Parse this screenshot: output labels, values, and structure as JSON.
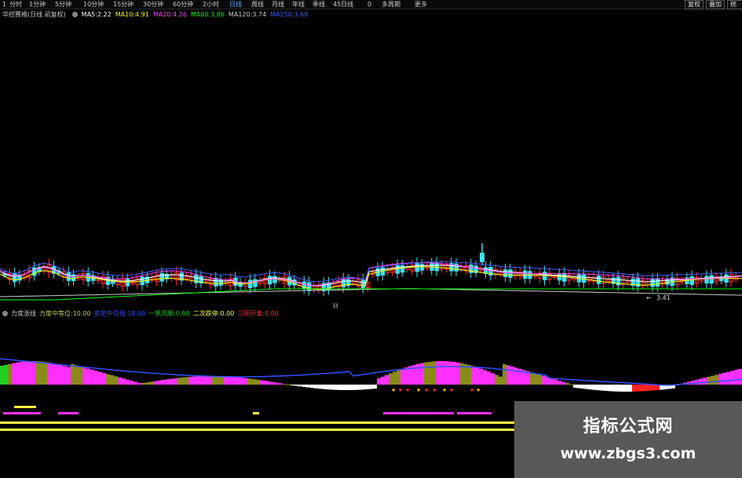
{
  "toolbar": {
    "timeframes": [
      "1",
      "分时",
      "1分钟",
      "5分钟",
      "10分钟",
      "15分钟",
      "30分钟",
      "60分钟",
      "2小时",
      "日线",
      "周线",
      "月线",
      "年线",
      "季线",
      "45日线",
      "0",
      "多周期",
      "更多"
    ],
    "active_timeframe": "日线",
    "right_buttons": [
      "复权",
      "叠加",
      "统计"
    ]
  },
  "main_info": {
    "stock": "华控赛格(日线 前复权)",
    "ma5_label": "MA5:",
    "ma5_value": "2.22",
    "ma10_label": "MA10:",
    "ma10_value": "4.91",
    "ma20_label": "MA20:",
    "ma20_value": "4.26",
    "ma60_label": "MA60:",
    "ma60_value": "3.86",
    "ma120_label": "MA120:",
    "ma120_value": "3.74",
    "ma250_label": "MA250:",
    "ma250_value": "3.68"
  },
  "chart_annotations": {
    "low_price": "3.41",
    "marker_label": "财"
  },
  "indicator_info": {
    "name": "力度涨线",
    "items": [
      {
        "label": "力度中等位:",
        "value": "10.00"
      },
      {
        "label": "资金中位线:",
        "value": "10.00"
      },
      {
        "label": "一帆风顺:",
        "value": "0.00"
      },
      {
        "label": "二次跌停:",
        "value": "0.00"
      },
      {
        "label": "三阳开泰:",
        "value": "0.00"
      }
    ]
  },
  "watermark": {
    "title": "指标公式网",
    "url": "www.zbgs3.com"
  },
  "colors": {
    "up": "#ff3030",
    "down": "#40e0f0",
    "ma5": "#ffffff",
    "ma10": "#ffff00",
    "ma20": "#ff40ff",
    "ma60": "#00ff00",
    "ma120": "#cccccc",
    "ma250": "#4060ff",
    "bar_magenta": "#ff30ff",
    "bar_olive": "#8a8a1a",
    "bar_white": "#ffffff",
    "bar_red": "#ff2020",
    "bar_green": "#20d020",
    "line_blue": "#3050ff",
    "signal_yellow": "#ffff40"
  }
}
